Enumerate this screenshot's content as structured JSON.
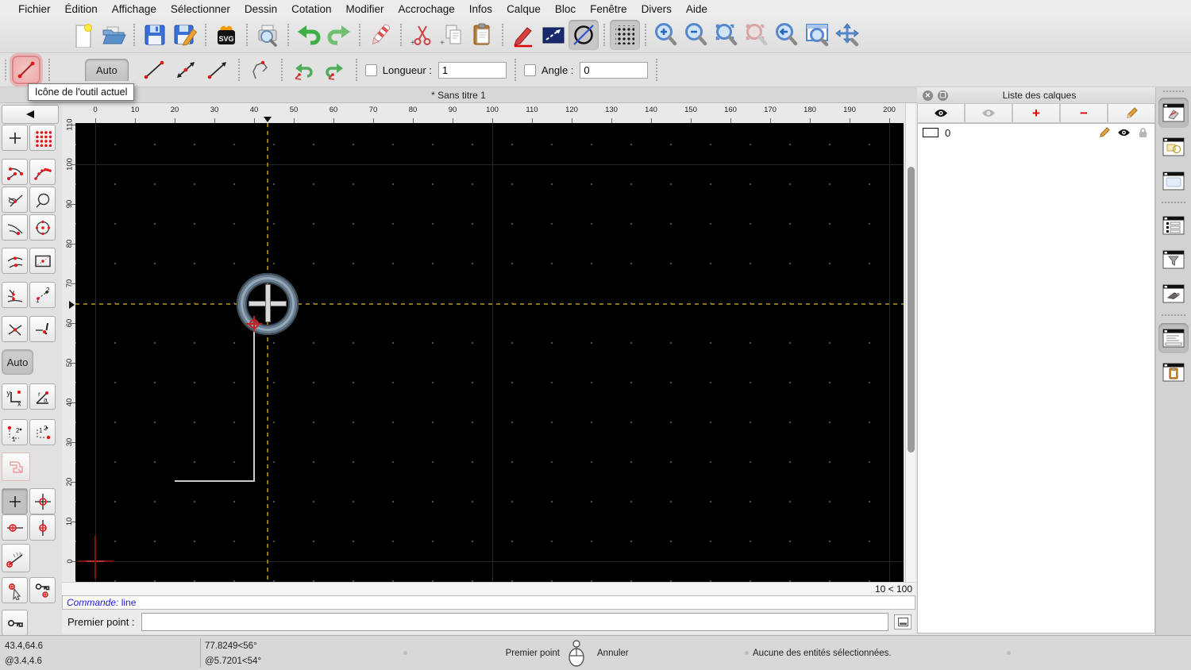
{
  "menu": {
    "items": [
      "Fichier",
      "Édition",
      "Affichage",
      "Sélectionner",
      "Dessin",
      "Cotation",
      "Modifier",
      "Accrochage",
      "Infos",
      "Calque",
      "Bloc",
      "Fenêtre",
      "Divers",
      "Aide"
    ]
  },
  "icons": {
    "toolbar_main": [
      "new-file",
      "open-file",
      "save",
      "save-as",
      "export-svg",
      "print-preview",
      "undo",
      "redo",
      "delete",
      "cut",
      "copy",
      "paste",
      "pen-attributes",
      "line-attributes",
      "circle-attributes",
      "grid-toggle",
      "zoom-in",
      "zoom-out",
      "zoom-auto",
      "zoom-previous",
      "zoom-back",
      "zoom-window",
      "zoom-pan"
    ],
    "snap_palette": [
      "back",
      "snap-free",
      "snap-grid",
      "snap-endpoint",
      "snap-on-entity",
      "snap-center",
      "snap-circle",
      "snap-tangent",
      "snap-center-point",
      "snap-middle",
      "snap-rectangle",
      "snap-intersection-auto",
      "snap-distance",
      "snap-intersection",
      "snap-intersection-manual",
      "coordinate-cartesian",
      "coordinate-polar",
      "sequence-1-2-a",
      "sequence-1-2-b",
      "restrict-disabled",
      "restrict-nothing",
      "restrict-orthogonal",
      "restrict-horizontal",
      "restrict-vertical",
      "angle-gauge",
      "set-relative-zero",
      "lock-relative-zero",
      "relative-zero-key"
    ],
    "dock": [
      "layer-list-window",
      "block-list-window",
      "library-browser-window",
      "entity-list-window",
      "filter-window",
      "pen-palette-window",
      "command-window",
      "clipboard-window"
    ]
  },
  "tool_options": {
    "auto_label": "Auto",
    "length_label": "Longueur :",
    "length_value": "1",
    "angle_label": "Angle :",
    "angle_value": "0"
  },
  "tooltip": "Icône de l'outil actuel",
  "tab_title": "* Sans titre 1",
  "ruler": {
    "h_labels": [
      "0",
      "10",
      "20",
      "30",
      "40",
      "50",
      "60",
      "70",
      "80",
      "90",
      "100",
      "110",
      "120",
      "130",
      "140",
      "150",
      "160",
      "170",
      "180",
      "190",
      "200"
    ],
    "v_labels": [
      "110",
      "100",
      "90",
      "80",
      "70",
      "60",
      "50",
      "40",
      "30",
      "20",
      "10",
      "0"
    ]
  },
  "canvas": {
    "grid_status": "10 < 100"
  },
  "palette": {
    "auto_label": "Auto"
  },
  "command": {
    "prompt_label": "Commande:",
    "prompt_value": "line",
    "input_label": "Premier point :",
    "input_value": ""
  },
  "layers_panel": {
    "title": "Liste des calques",
    "layers": [
      {
        "name": "0"
      }
    ]
  },
  "statusbar": {
    "abs_coord": "43.4,64.6",
    "rel_coord": "@3.4,4.6",
    "polar_abs": "77.8249<56°",
    "polar_rel": "@5.7201<54°",
    "left_button_action": "Premier point",
    "right_button_action": "Annuler",
    "selection_status": "Aucune des entités sélectionnées."
  },
  "colors": {
    "accent_red": "#e21212",
    "crosshair_olive": "#8c7514",
    "command_blue": "#1a1ad2",
    "canvas_black": "#000000",
    "snap_ring_blue": "#94a8b9"
  }
}
